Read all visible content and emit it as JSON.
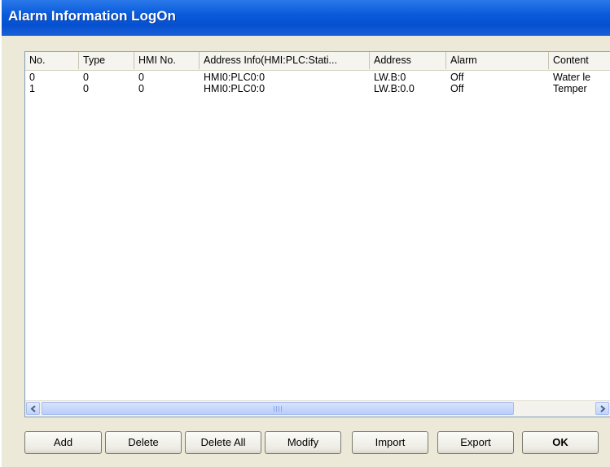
{
  "window": {
    "title": "Alarm Information LogOn"
  },
  "table": {
    "columns": [
      "No.",
      "Type",
      "HMI No.",
      "Address Info(HMI:PLC:Stati...",
      "Address",
      "Alarm",
      "Content"
    ],
    "rows": [
      [
        "0",
        "0",
        "0",
        "HMI0:PLC0:0",
        "LW.B:0",
        "Off",
        "Water le"
      ],
      [
        "1",
        "0",
        "0",
        "HMI0:PLC0:0",
        "LW.B:0.0",
        "Off",
        "Temper"
      ]
    ]
  },
  "buttons": {
    "add": "Add",
    "delete": "Delete",
    "delete_all": "Delete All",
    "modify": "Modify",
    "import": "Import",
    "export": "Export",
    "ok": "OK"
  },
  "icons": {
    "scroll_left": "chevron-left-icon",
    "scroll_right": "chevron-right-icon",
    "thumb_grip": "grip-icon"
  },
  "colors": {
    "titlebar": "#0a5bdc",
    "dialog_bg": "#ece9d8",
    "list_border": "#7f9db9"
  }
}
